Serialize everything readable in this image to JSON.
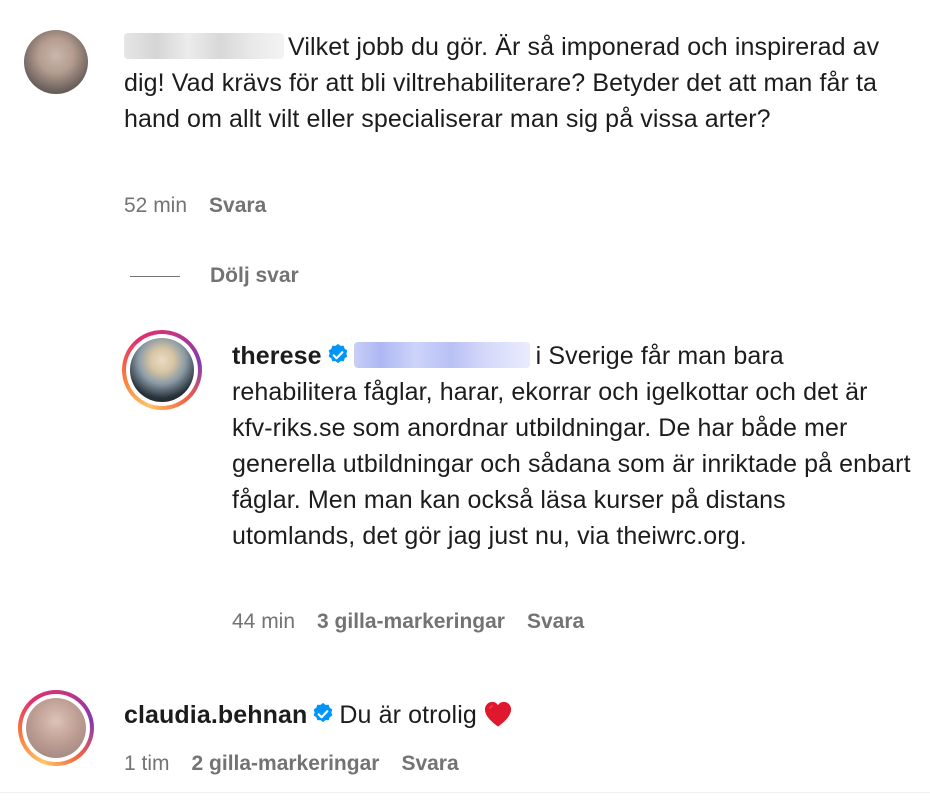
{
  "comments": [
    {
      "text": "Vilket jobb du gör. Är så imponerad och inspirerad av dig! Vad krävs för att bli viltrehabiliterare? Betyder det att man får ta hand om allt vilt eller specialiserar man sig på vissa arter?",
      "time": "52 min",
      "reply_label": "Svara"
    }
  ],
  "hide_replies_label": "Dölj svar",
  "reply": {
    "username": "therese",
    "text": "i Sverige får man bara rehabilitera fåglar, harar, ekorrar och igelkottar och det är kfv-riks.se som anordnar utbildningar. De har både mer generella utbildningar och sådana som är inriktade på enbart fåglar. Men man kan också läsa kurser på distans utomlands, det gör jag just nu, via theiwrc.org.",
    "time": "44 min",
    "likes": "3 gilla-markeringar",
    "reply_label": "Svara"
  },
  "comment3": {
    "username": "claudia.behnan",
    "text": "Du är otrolig",
    "time": "1 tim",
    "likes": "2 gilla-markeringar",
    "reply_label": "Svara"
  },
  "icons": {
    "verified": "verified-badge-icon",
    "heart": "red-heart-emoji"
  },
  "colors": {
    "verified_blue": "#0095f6",
    "meta_gray": "#737373",
    "heart_red": "#e0182d"
  }
}
